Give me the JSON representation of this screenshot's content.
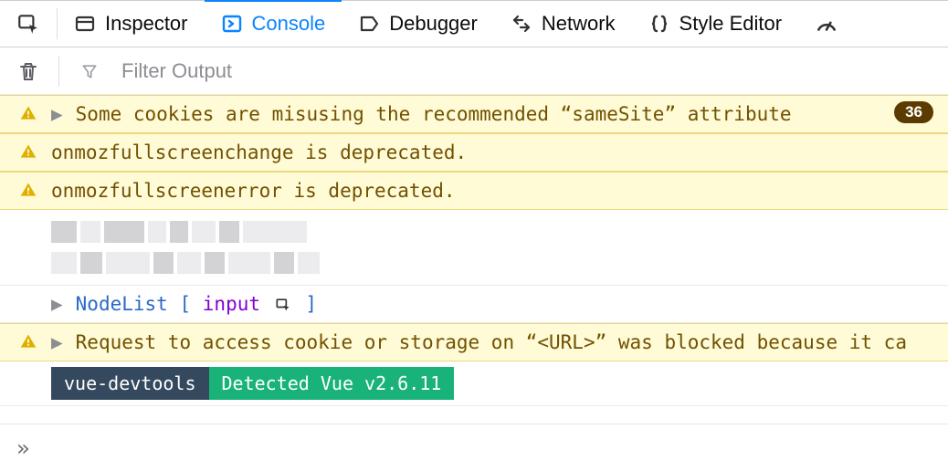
{
  "tabs": {
    "inspector": "Inspector",
    "console": "Console",
    "debugger": "Debugger",
    "network": "Network",
    "style_editor": "Style Editor"
  },
  "filter": {
    "placeholder": "Filter Output"
  },
  "messages": {
    "cookies_warning": "Some cookies are misusing the recommended “sameSite” attribute",
    "cookies_count": "36",
    "deprec1": "onmozfullscreenchange is deprecated.",
    "deprec2": "onmozfullscreenerror is deprecated.",
    "nodelist_kw": "NodeList",
    "nodelist_open": "[",
    "nodelist_elem": "input",
    "nodelist_close": "]",
    "storage_warning": "Request to access cookie or storage on “<URL>” was blocked because it ca",
    "vue_label": "vue-devtools",
    "vue_detected": "Detected Vue v2.6.11"
  },
  "prompt": "»"
}
